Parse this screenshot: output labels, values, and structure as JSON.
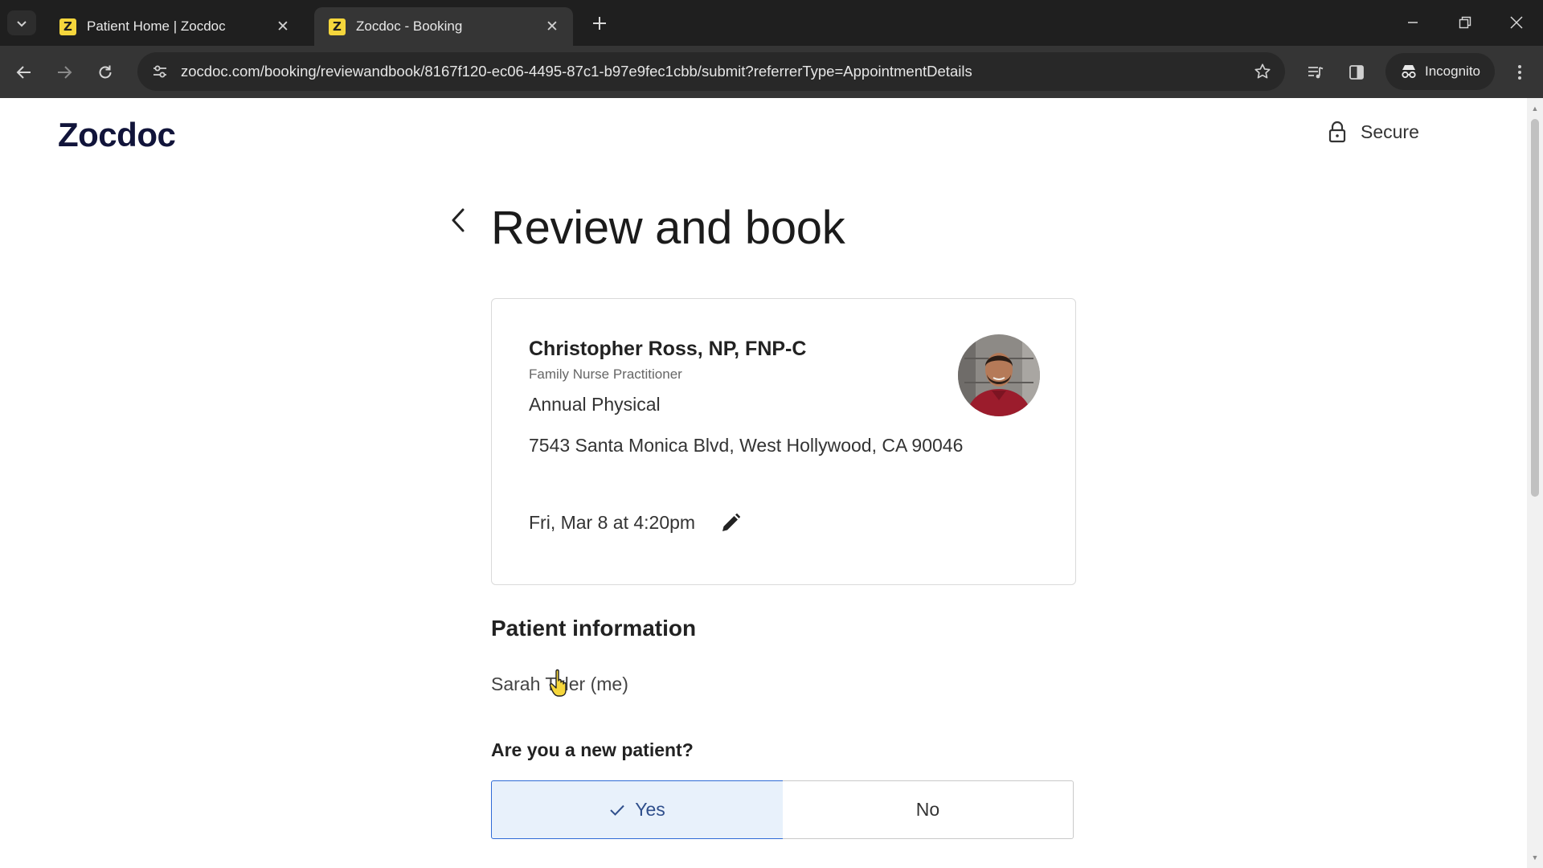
{
  "browser": {
    "tabs": [
      {
        "title": "Patient Home | Zocdoc",
        "favicon": "Z",
        "active": false
      },
      {
        "title": "Zocdoc - Booking",
        "favicon": "Z",
        "active": true
      }
    ],
    "url": "zocdoc.com/booking/reviewandbook/8167f120-ec06-4495-87c1-b97e9fec1cbb/submit?referrerType=AppointmentDetails",
    "incognito_label": "Incognito",
    "colors": {
      "tabbar": "#1f1f1f",
      "toolbar": "#353535",
      "favicon": "#f5d63c"
    }
  },
  "header": {
    "logo": "Zocdoc",
    "secure_label": "Secure"
  },
  "page": {
    "title": "Review and book"
  },
  "appointment": {
    "provider_name": "Christopher Ross, NP, FNP-C",
    "specialty": "Family Nurse Practitioner",
    "visit_reason": "Annual Physical",
    "address": "7543 Santa Monica Blvd, West Hollywood, CA 90046",
    "datetime": "Fri, Mar 8 at 4:20pm"
  },
  "patient": {
    "section_title": "Patient information",
    "name": "Sarah Tyler (me)",
    "new_patient_question": "Are you a new patient?",
    "options": {
      "yes": "Yes",
      "no": "No"
    },
    "selected": "yes",
    "accent_color": "#2f6bd6"
  }
}
